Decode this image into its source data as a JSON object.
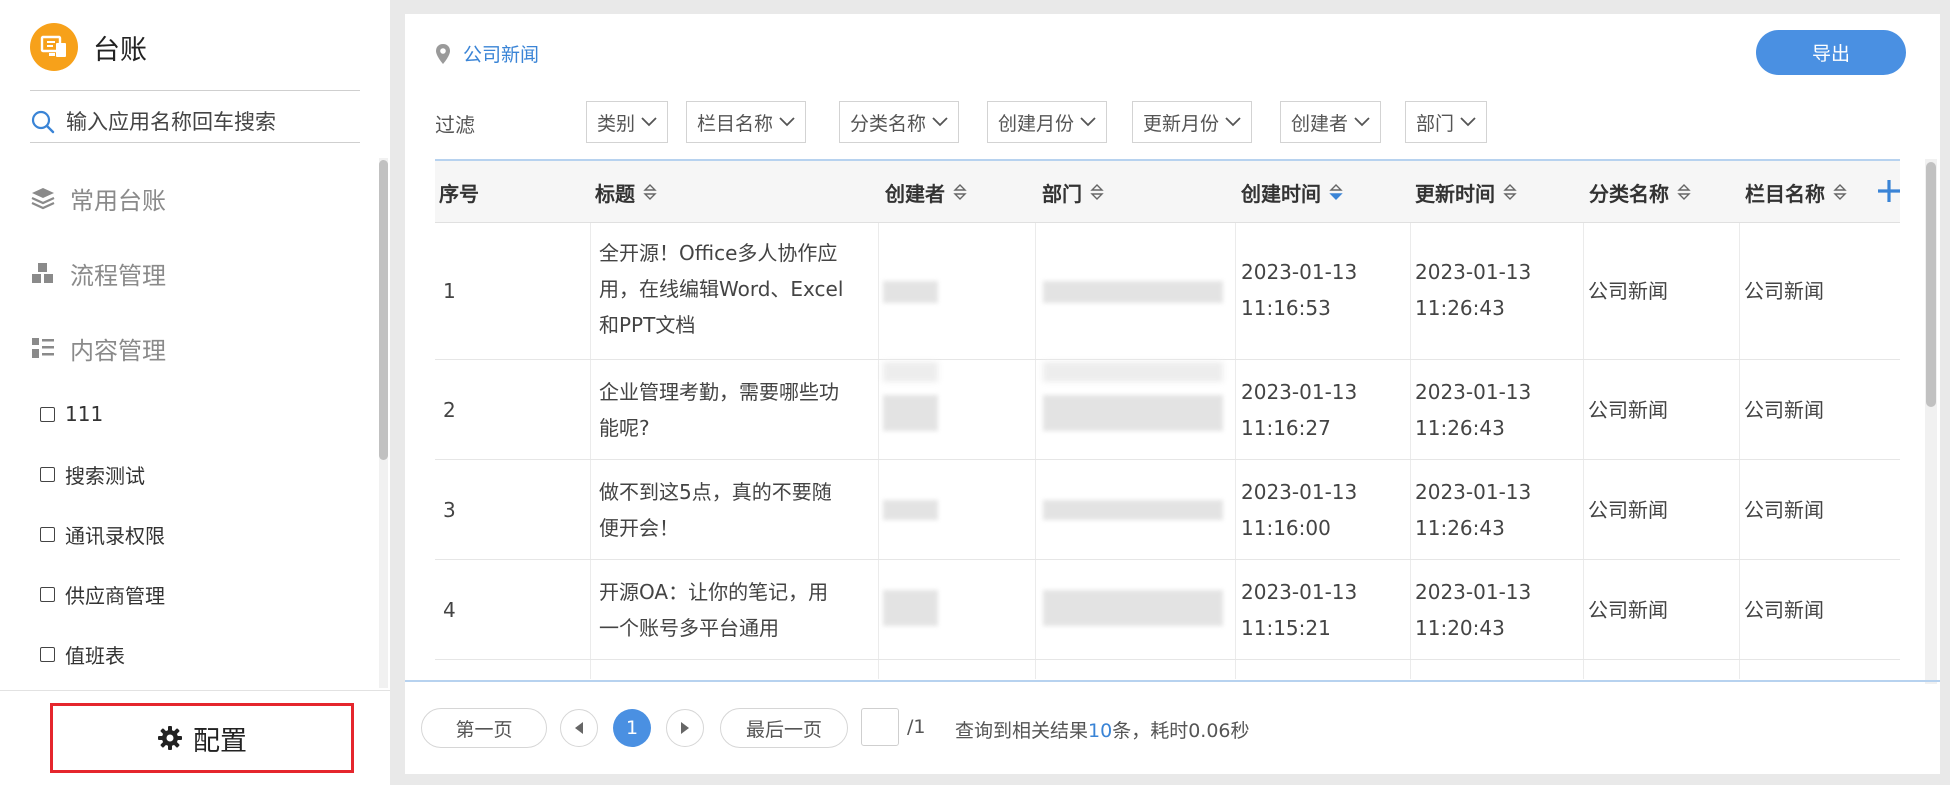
{
  "app": {
    "title": "台账",
    "search_placeholder": "输入应用名称回车搜索",
    "accent_color": "#4a90e2",
    "logo_color": "#f7a11a"
  },
  "sidebar": {
    "groups": [
      {
        "label": "常用台账",
        "icon": "layers-icon"
      },
      {
        "label": "流程管理",
        "icon": "blocks-icon"
      },
      {
        "label": "内容管理",
        "icon": "list-icon"
      }
    ],
    "items": [
      {
        "label": "111"
      },
      {
        "label": "搜索测试"
      },
      {
        "label": "通讯录权限"
      },
      {
        "label": "供应商管理"
      },
      {
        "label": "值班表"
      }
    ],
    "config_label": "配置"
  },
  "main": {
    "breadcrumb": "公司新闻",
    "export_label": "导出",
    "filter_label": "过滤",
    "filters": [
      "类别",
      "栏目名称",
      "分类名称",
      "创建月份",
      "更新月份",
      "创建者",
      "部门"
    ],
    "columns": [
      "序号",
      "标题",
      "创建者",
      "部门",
      "创建时间",
      "更新时间",
      "分类名称",
      "栏目名称"
    ],
    "active_sort_column": "创建时间",
    "rows": [
      {
        "no": "1",
        "title_lines": [
          "全开源！Office多人协作应",
          "用，在线编辑Word、Excel",
          "和PPT文档"
        ],
        "created_date": "2023-01-13",
        "created_time": "11:16:53",
        "updated_date": "2023-01-13",
        "updated_time": "11:26:43",
        "category": "公司新闻",
        "column": "公司新闻"
      },
      {
        "no": "2",
        "title_lines": [
          "企业管理考勤，需要哪些功",
          "能呢?"
        ],
        "created_date": "2023-01-13",
        "created_time": "11:16:27",
        "updated_date": "2023-01-13",
        "updated_time": "11:26:43",
        "category": "公司新闻",
        "column": "公司新闻"
      },
      {
        "no": "3",
        "title_lines": [
          "做不到这5点，真的不要随",
          "便开会！"
        ],
        "created_date": "2023-01-13",
        "created_time": "11:16:00",
        "updated_date": "2023-01-13",
        "updated_time": "11:26:43",
        "category": "公司新闻",
        "column": "公司新闻"
      },
      {
        "no": "4",
        "title_lines": [
          "开源OA：让你的笔记，用",
          "一个账号多平台通用"
        ],
        "created_date": "2023-01-13",
        "created_time": "11:15:21",
        "updated_date": "2023-01-13",
        "updated_time": "11:20:43",
        "category": "公司新闻",
        "column": "公司新闻"
      }
    ]
  },
  "pager": {
    "first_label": "第一页",
    "current_page": "1",
    "last_label": "最后一页",
    "total_pages": "/1",
    "result_prefix": "查询到相关结果",
    "result_count": "10",
    "result_suffix": "条，耗时0.06秒"
  }
}
